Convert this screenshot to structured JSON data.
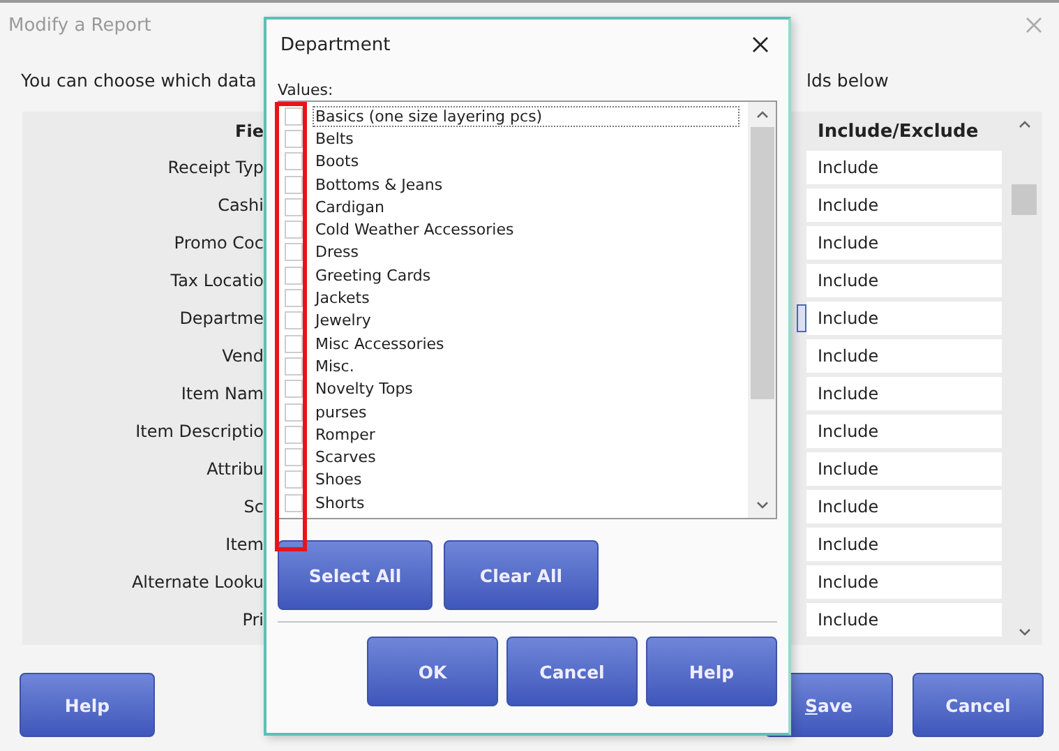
{
  "window": {
    "title": "Modify a Report"
  },
  "instruction": {
    "left": "You can choose which data",
    "right": "lds below"
  },
  "grid": {
    "field_header": "Fie",
    "include_header": "Include/Exclude",
    "rows": [
      {
        "field": "Receipt Typ",
        "include": "Include"
      },
      {
        "field": "Cashi",
        "include": "Include"
      },
      {
        "field": "Promo Coc",
        "include": "Include"
      },
      {
        "field": "Tax Locatio",
        "include": "Include"
      },
      {
        "field": "Departme",
        "include": "Include"
      },
      {
        "field": "Vend",
        "include": "Include"
      },
      {
        "field": "Item Nam",
        "include": "Include"
      },
      {
        "field": "Item Descriptio",
        "include": "Include"
      },
      {
        "field": "Attribu",
        "include": "Include"
      },
      {
        "field": "Sc",
        "include": "Include"
      },
      {
        "field": "Item",
        "include": "Include"
      },
      {
        "field": "Alternate Looku",
        "include": "Include"
      },
      {
        "field": "Pri",
        "include": "Include"
      }
    ]
  },
  "buttons": {
    "help": "Help",
    "save": "Save",
    "cancel": "Cancel"
  },
  "dialog": {
    "title": "Department",
    "values_label": "Values:",
    "values": [
      {
        "label": "Basics (one size layering pcs)",
        "checked": false,
        "focused": true
      },
      {
        "label": "Belts",
        "checked": false,
        "focused": false
      },
      {
        "label": "Boots",
        "checked": false,
        "focused": false
      },
      {
        "label": "Bottoms & Jeans",
        "checked": false,
        "focused": false
      },
      {
        "label": "Cardigan",
        "checked": false,
        "focused": false
      },
      {
        "label": "Cold Weather Accessories",
        "checked": false,
        "focused": false
      },
      {
        "label": "Dress",
        "checked": false,
        "focused": false
      },
      {
        "label": "Greeting Cards",
        "checked": false,
        "focused": false
      },
      {
        "label": "Jackets",
        "checked": false,
        "focused": false
      },
      {
        "label": "Jewelry",
        "checked": false,
        "focused": false
      },
      {
        "label": "Misc Accessories",
        "checked": false,
        "focused": false
      },
      {
        "label": "Misc.",
        "checked": false,
        "focused": false
      },
      {
        "label": "Novelty Tops",
        "checked": false,
        "focused": false
      },
      {
        "label": "purses",
        "checked": false,
        "focused": false
      },
      {
        "label": "Romper",
        "checked": false,
        "focused": false
      },
      {
        "label": "Scarves",
        "checked": false,
        "focused": false
      },
      {
        "label": "Shoes",
        "checked": false,
        "focused": false
      },
      {
        "label": "Shorts",
        "checked": false,
        "focused": false
      }
    ],
    "select_all": "Select All",
    "clear_all": "Clear All",
    "ok": "OK",
    "cancel": "Cancel",
    "help": "Help"
  }
}
